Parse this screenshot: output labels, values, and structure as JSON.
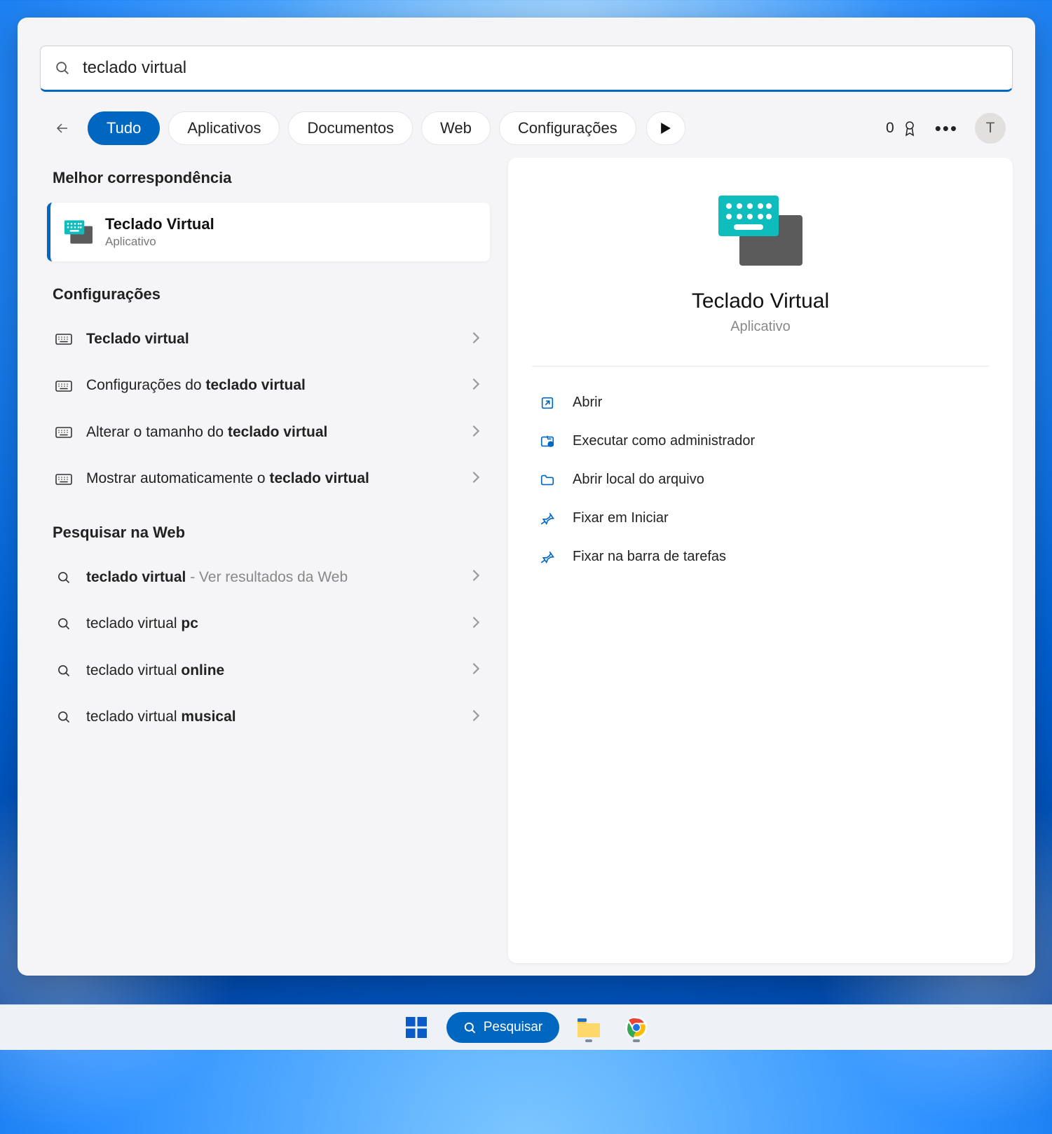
{
  "search": {
    "query": "teclado virtual"
  },
  "toolbar": {
    "back_aria": "Voltar",
    "filters": [
      "Tudo",
      "Aplicativos",
      "Documentos",
      "Web",
      "Configurações"
    ],
    "active_filter": 0,
    "play_aria": "Executar",
    "points": "0",
    "more_aria": "Mais opções",
    "user_initial": "T"
  },
  "sections": {
    "best_match_header": "Melhor correspondência",
    "settings_header": "Configurações",
    "web_header": "Pesquisar na Web"
  },
  "best_match": {
    "title": "Teclado Virtual",
    "type": "Aplicativo"
  },
  "settings_results": [
    {
      "pre": "",
      "bold": "Teclado virtual",
      "post": ""
    },
    {
      "pre": "Configurações do ",
      "bold": "teclado virtual",
      "post": ""
    },
    {
      "pre": "Alterar o tamanho do ",
      "bold": "teclado virtual",
      "post": ""
    },
    {
      "pre": "Mostrar automaticamente o ",
      "bold": "teclado virtual",
      "post": ""
    }
  ],
  "web_results": [
    {
      "pre": "",
      "bold": "teclado virtual",
      "post": "",
      "meta": " - Ver resultados da Web"
    },
    {
      "pre": "teclado virtual ",
      "bold": "pc",
      "post": "",
      "meta": ""
    },
    {
      "pre": "teclado virtual ",
      "bold": "online",
      "post": "",
      "meta": ""
    },
    {
      "pre": "teclado virtual ",
      "bold": "musical",
      "post": "",
      "meta": ""
    }
  ],
  "details": {
    "title": "Teclado Virtual",
    "type": "Aplicativo",
    "actions": [
      {
        "icon": "open",
        "label": "Abrir"
      },
      {
        "icon": "admin",
        "label": "Executar como administrador"
      },
      {
        "icon": "folder",
        "label": "Abrir local do arquivo"
      },
      {
        "icon": "pin",
        "label": "Fixar em Iniciar"
      },
      {
        "icon": "pin",
        "label": "Fixar na barra de tarefas"
      }
    ]
  },
  "taskbar": {
    "search_label": "Pesquisar"
  }
}
